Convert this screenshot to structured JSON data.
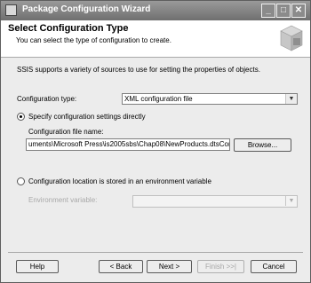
{
  "window": {
    "title": "Package Configuration Wizard",
    "controls": {
      "minimize": "_",
      "maximize": "□",
      "close": "✕"
    }
  },
  "header": {
    "title": "Select Configuration Type",
    "subtitle": "You can select the type of configuration to create."
  },
  "body": {
    "intro": "SSIS supports a variety of sources to use for setting the properties of objects.",
    "config_type_label": "Configuration type:",
    "config_type_value": "XML configuration file",
    "option_direct": "Specify configuration settings directly",
    "file_name_label": "Configuration file name:",
    "file_name_value": "uments\\Microsoft Press\\is2005sbs\\Chap08\\NewProducts.dtsConfig",
    "browse_label": "Browse...",
    "option_env": "Configuration location is stored in an environment variable",
    "env_var_label": "Environment variable:"
  },
  "footer": {
    "help": "Help",
    "back": "< Back",
    "next": "Next >",
    "finish": "Finish >>|",
    "cancel": "Cancel"
  },
  "colors": {
    "titlebar": "#7f7f7f",
    "window": "#ececec",
    "header": "#ffffff"
  }
}
